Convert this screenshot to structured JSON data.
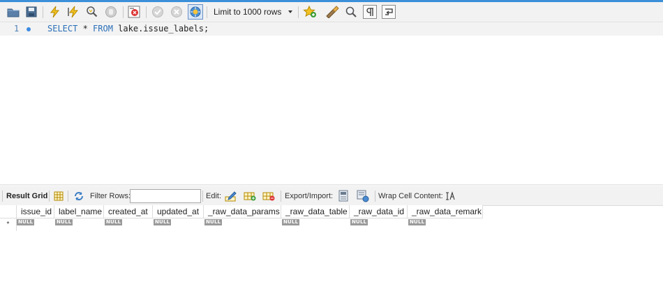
{
  "toolbar": {
    "limit_select": {
      "value": "Limit to 1000 rows"
    },
    "icons": [
      "open-folder-icon",
      "save-icon",
      "execute-icon",
      "execute-current-icon",
      "explain-icon",
      "stop-icon",
      "toggle-errors-icon",
      "commit-icon",
      "rollback-icon",
      "autocommit-icon",
      "beautify-icon",
      "find-icon",
      "invisible-chars-icon",
      "wrap-icon",
      "add-snippet-icon"
    ]
  },
  "editor": {
    "line_number": "1",
    "code": {
      "kw1": "SELECT",
      "rest1": " * ",
      "kw2": "FROM",
      "rest2": " lake.issue_labels;"
    }
  },
  "result_toolbar": {
    "result_grid_label": "Result Grid",
    "filter_rows_label": "Filter Rows:",
    "filter_value": "",
    "edit_label": "Edit:",
    "export_import_label": "Export/Import:",
    "wrap_cell_label": "Wrap Cell Content:"
  },
  "grid": {
    "columns": [
      "issue_id",
      "label_name",
      "created_at",
      "updated_at",
      "_raw_data_params",
      "_raw_data_table",
      "_raw_data_id",
      "_raw_data_remark"
    ],
    "new_row_marker": "*",
    "null_text": "NULL"
  },
  "colors": {
    "accent": "#3a8fd8",
    "keyword": "#2a6fb8",
    "null_badge": "#9a9a9a"
  }
}
